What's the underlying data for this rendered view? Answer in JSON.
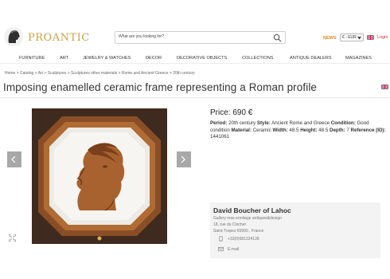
{
  "header": {
    "brand": "PROANTIC",
    "search_placeholder": "What are you looking for?",
    "news": "NEWS",
    "currency": "€ - EUR",
    "login": "Login"
  },
  "nav": {
    "items": [
      "FURNITURE",
      "ART",
      "JEWELRY & WATCHES",
      "DECOR",
      "DECORATIVE OBJECTS",
      "COLLECTIONS",
      "ANTIQUE DEALERS",
      "MAGAZINES"
    ]
  },
  "breadcrumb": "Home > Catalog > Art > Sculptures > Sculptures other materials > Rome and Ancient Greece > 20th century",
  "product": {
    "title": "Imposing enamelled ceramic frame representing a Roman profile",
    "price": "Price: 690 €",
    "period_label": "Period:",
    "period": "20th century",
    "style_label": "Style:",
    "style": "Ancient Rome and Greece",
    "condition_label": "Condition:",
    "condition": "Good condition",
    "material_label": "Material:",
    "material": "Ceramic",
    "width_label": "Width:",
    "width": "48.5",
    "height_label": "Height:",
    "height": "48.5",
    "depth_label": "Depth:",
    "depth": "7",
    "reference_label": "Reference (ID):",
    "reference": "1441061"
  },
  "dealer": {
    "name": "David Boucher of Lahoc",
    "gallery": "Gallery mas ermitage antiques&design",
    "street": "18, rue du Clocher",
    "city": "Saint-Tropez 83990 , France",
    "phone": "+33(0)681324138",
    "email": "E-mail"
  },
  "colors": {
    "brand_gold": "#c8a24a",
    "news_orange": "#e08a1e",
    "login_red": "#c0392b",
    "arrow_gray": "#a8a8a8"
  }
}
